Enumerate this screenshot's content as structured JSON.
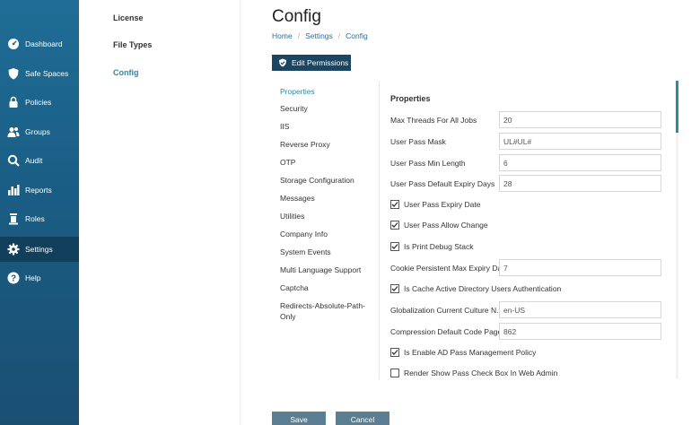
{
  "nav": {
    "items": [
      {
        "label": "Dashboard",
        "icon": "dashboard-icon"
      },
      {
        "label": "Safe Spaces",
        "icon": "shield-icon"
      },
      {
        "label": "Policies",
        "icon": "lock-icon"
      },
      {
        "label": "Groups",
        "icon": "users-icon"
      },
      {
        "label": "Audit",
        "icon": "search-icon"
      },
      {
        "label": "Reports",
        "icon": "bar-chart-icon"
      },
      {
        "label": "Roles",
        "icon": "roles-icon"
      },
      {
        "label": "Settings",
        "icon": "gear-icon"
      },
      {
        "label": "Help",
        "icon": "help-icon"
      }
    ],
    "active": "Settings"
  },
  "subnav": {
    "items": [
      {
        "label": "License"
      },
      {
        "label": "File Types"
      },
      {
        "label": "Config"
      }
    ],
    "active": "Config"
  },
  "page": {
    "title": "Config",
    "breadcrumb": [
      "Home",
      "Settings",
      "Config"
    ],
    "edit_permissions_label": "Edit Permissions"
  },
  "sections": {
    "items": [
      "Properties",
      "Security",
      "IIS",
      "Reverse Proxy",
      "OTP",
      "Storage Configuration",
      "Messages",
      "Utilities",
      "Company Info",
      "System Events",
      "Multi Language Support",
      "Captcha",
      "Redirects-Absolute-Path-Only"
    ],
    "active": "Properties"
  },
  "properties": {
    "title": "Properties",
    "fields": [
      {
        "label": "Max Threads For All Jobs",
        "value": "20"
      },
      {
        "label": "User Pass Mask",
        "value": "UL#UL#"
      },
      {
        "label": "User Pass Min Length",
        "value": "6"
      },
      {
        "label": "User Pass Default Expiry Days",
        "value": "28"
      }
    ],
    "checks_a": [
      {
        "label": "User Pass Expiry Date",
        "checked": true
      },
      {
        "label": "User Pass Allow Change",
        "checked": true
      },
      {
        "label": "Is Print Debug Stack",
        "checked": true
      }
    ],
    "cookie_field": {
      "label": "Cookie Persistent Max Expiry Date",
      "value": "7"
    },
    "check_cache": {
      "label": "Is Cache Active Directory Users Authentication",
      "checked": true
    },
    "fields_b": [
      {
        "label": "Globalization Current Culture N...",
        "value": "en-US"
      },
      {
        "label": "Compression Default Code Page",
        "value": "862"
      }
    ],
    "checks_b": [
      {
        "label": "Is Enable AD Pass Management Policy",
        "checked": true
      },
      {
        "label": "Render Show Pass Check Box In Web Admin",
        "checked": false
      }
    ]
  },
  "footer": {
    "save_label": "Save",
    "cancel_label": "Cancel"
  },
  "colors": {
    "nav_bg": "#1f6d96",
    "nav_active": "#123f5c",
    "accent": "#2a8aa8",
    "primary_button": "#1b4560",
    "footer_button": "#5b7e93"
  }
}
